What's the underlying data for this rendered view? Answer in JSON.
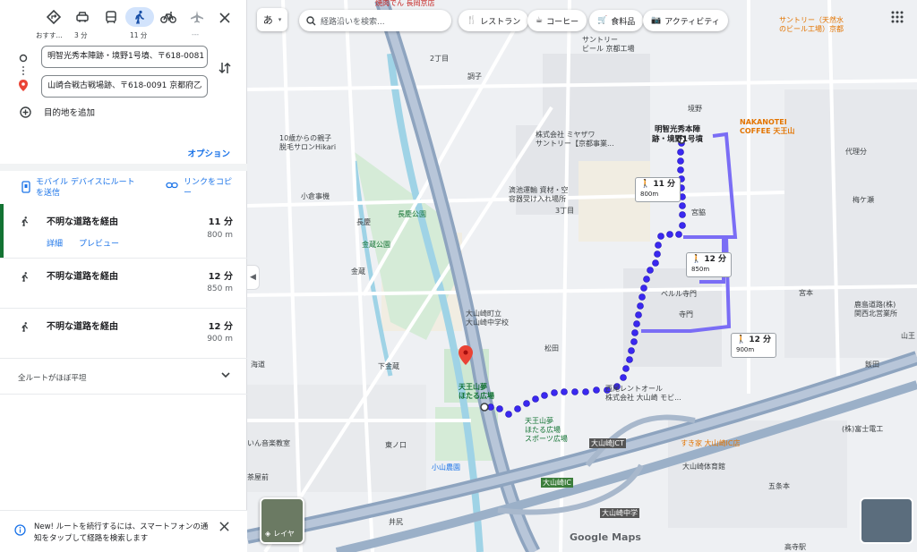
{
  "travel_modes": [
    {
      "name": "おすす...",
      "icon": "directions-icon"
    },
    {
      "name": "3 分",
      "icon": "car-icon"
    },
    {
      "name": "",
      "icon": "transit-icon"
    },
    {
      "name": "11 分",
      "icon": "walk-icon",
      "selected": true
    },
    {
      "name": "",
      "icon": "bicycle-icon"
    },
    {
      "name": "---",
      "icon": "flight-icon"
    }
  ],
  "origin": "明智光秀本陣跡・境野1号墳、〒618-0081",
  "destination": "山崎合戦古戦場跡、〒618-0091 京都府乙",
  "add_destination": "目的地を追加",
  "options": "オプション",
  "send_to_mobile": "モバイル デバイスにルートを送信",
  "copy_link": "リンクをコピー",
  "routes": [
    {
      "title": "不明な道路を経由",
      "time": "11 分",
      "distance": "800 m",
      "details": "詳細",
      "preview": "プレビュー"
    },
    {
      "title": "不明な道路を経由",
      "time": "12 分",
      "distance": "850 m"
    },
    {
      "title": "不明な道路を経由",
      "time": "12 分",
      "distance": "900 m"
    }
  ],
  "flat_note": "全ルートがほぼ平坦",
  "notice": "New! ルートを続行するには、スマートフォンの通知をタップして経路を検索します",
  "map": {
    "lang_button": "あ",
    "search_placeholder": "経路沿いを検索...",
    "chips": [
      "レストラン",
      "コーヒー",
      "食料品",
      "アクティビティ"
    ],
    "route_labels": [
      {
        "time": "11 分",
        "dist": "800m"
      },
      {
        "time": "12 分",
        "dist": "850m"
      },
      {
        "time": "12 分",
        "dist": "900m"
      }
    ],
    "start_label": "明智光秀本陣\n跡・境野1号墳",
    "end_label": "天王山夢\nほたる広場",
    "layers": "レイヤ",
    "logo": "Google Maps",
    "places": [
      "焼肉でん 長岡京店",
      "サントリー（天然水\nのビール工場）京都",
      "サントリー\nビール 京都工場",
      "2丁目",
      "調子",
      "株式会社 ミヤザワ\nサントリー【京都事業...",
      "滴池運輸 資材・空\n容器受け入れ場所",
      "3丁目",
      "10歳からの親子\n脱毛サロンHikari",
      "小倉事機",
      "長慶",
      "長慶公園",
      "金蔵公園",
      "金蔵",
      "大山崎町立\n大山崎中学校",
      "松田",
      "下金蔵",
      "ベルル寺門",
      "寺門",
      "宮脇",
      "境野",
      "代理分",
      "梅ケ瀬",
      "鹿島道路(株)\n関西北営業所",
      "宮本",
      "西尾レントオール\n株式会社 大山崎 モビ...",
      "天王山夢\nほたる広場\nスポーツ広場",
      "小山農園",
      "大山崎IC",
      "大山崎JCT",
      "大山崎体育館",
      "すき家 大山崎IC店",
      "(株)富士電工",
      "五条本",
      "大山崎中学",
      "茶屋前",
      "井尻",
      "海道",
      "東ノ口",
      "いん音楽教室",
      "NAKANOTEI\nCOFFEE 天王山",
      "飯田",
      "山王",
      "高寺駅"
    ]
  },
  "colors": {
    "route": "#3a28f0",
    "route_alt": "#6b5cf5",
    "accent": "#1a73e8",
    "selected_bg": "#d2e3fc"
  }
}
